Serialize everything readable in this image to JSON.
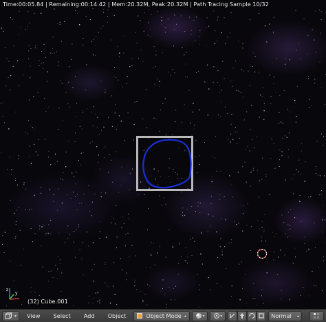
{
  "viewport": {
    "render_status": "Time:00:05.84 | Remaining:00:14.42 | Mem:20.32M, Peak:20.32M | Path Tracing Sample 10/32",
    "object_info": "(32) Cube.001"
  },
  "header": {
    "editor_icon": "view3d-icon",
    "menus": [
      "View",
      "Select",
      "Add",
      "Object"
    ],
    "mode_label": "Object Mode",
    "orientation_label": "Normal"
  },
  "colors": {
    "mesh_outline": "#1a2fd6",
    "selection_frame": "#b8b8b8",
    "cursor_3d": "#d9473f",
    "axis_x": "#d23a3a",
    "axis_y": "#58c046",
    "axis_z": "#3e6ee0",
    "header_bg": "#464646"
  }
}
